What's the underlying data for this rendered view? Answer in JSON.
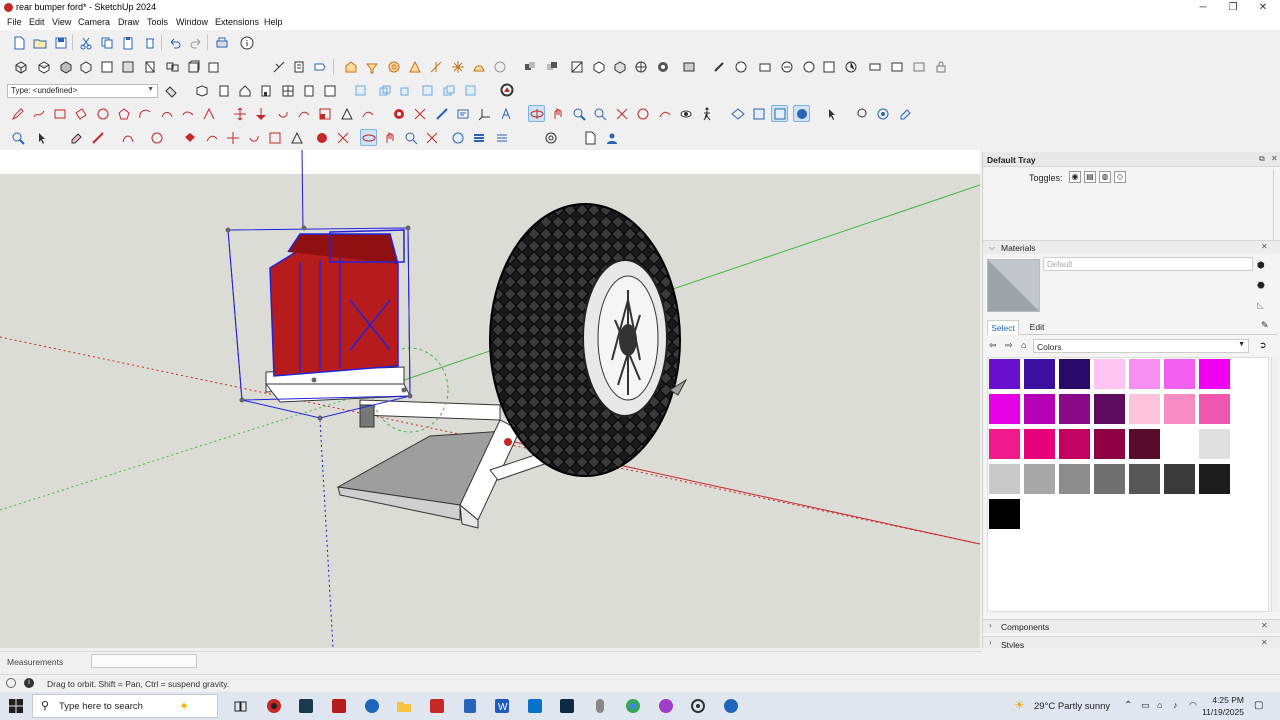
{
  "window": {
    "title": "rear bumper ford* - SketchUp 2024",
    "minimize": "─",
    "maximize": "❐",
    "close": "✕"
  },
  "menu": [
    "File",
    "Edit",
    "View",
    "Camera",
    "Draw",
    "Tools",
    "Window",
    "Extensions",
    "Help"
  ],
  "toolbar": {
    "type_selector": "Type: <undefined>"
  },
  "tray": {
    "title": "Default Tray",
    "toggles_label": "Toggles:",
    "materials_label": "Materials",
    "material_name_placeholder": "Default",
    "tabs": [
      "Select",
      "Edit"
    ],
    "library": "Colors",
    "swatches": [
      "#6b0fcf",
      "#3d0f9e",
      "#2a0a68",
      "#ffc4f2",
      "#f78ef2",
      "#f15ef0",
      "#f000f0",
      "#e600e6",
      "#b400b4",
      "#8a0a8a",
      "#5e0a5e",
      "#ffc4dc",
      "#f88bc4",
      "#f057b0",
      "#f01a8a",
      "#e6007a",
      "#c40060",
      "#8e0044",
      "#5a0a2a",
      "#ffffff",
      "#e0e0e0",
      "#c8c8c8",
      "#a8a8a8",
      "#8c8c8c",
      "#707070",
      "#555555",
      "#3a3a3a",
      "#1c1c1c",
      "#000000"
    ],
    "components_label": "Components",
    "styles_label": "Styles"
  },
  "measurements_label": "Measurements",
  "status_hint": "Drag to orbit. Shift = Pan, Ctrl = suspend gravity.",
  "taskbar": {
    "search_placeholder": "Type here to search",
    "weather": "29°C  Partly sunny",
    "time": "4:25 PM",
    "date": "11/19/2025"
  },
  "colors": {
    "axis_red": "#c62828",
    "axis_green": "#3fb63f",
    "axis_blue": "#1a1ad0",
    "selection": "#2222dd",
    "jerry_can": "#b71c1c"
  }
}
